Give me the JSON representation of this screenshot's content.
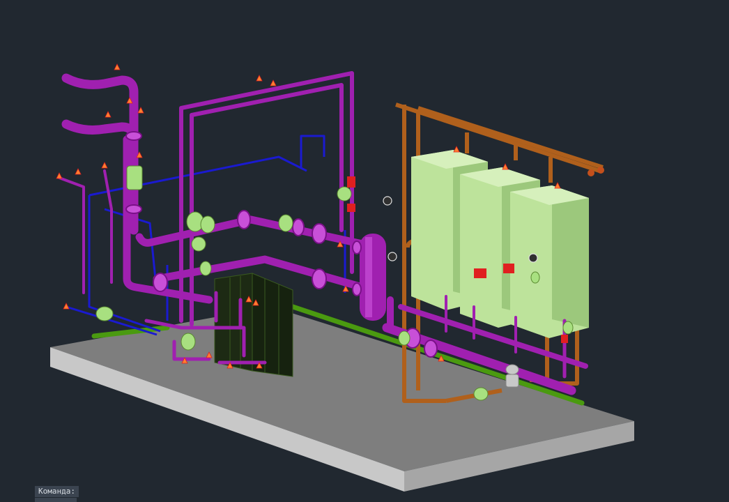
{
  "window": {
    "background": "#212830"
  },
  "colors": {
    "platform_top": "#7e7e7e",
    "platform_front": "#c8c8c8",
    "platform_side": "#a6a6a6",
    "pipe_magenta": "#a020b0",
    "pipe_magenta_light": "#c850d8",
    "pipe_blue": "#1a1ad0",
    "pipe_copper": "#b0601c",
    "pipe_green": "#4a9a10",
    "boiler_body": "#bde39b",
    "boiler_shade": "#9cc87c",
    "valve_green": "#a8e080",
    "valve_red": "#e02020",
    "plate_hx": "#1d2a14"
  },
  "command_line": {
    "prompt": "Команда:"
  }
}
